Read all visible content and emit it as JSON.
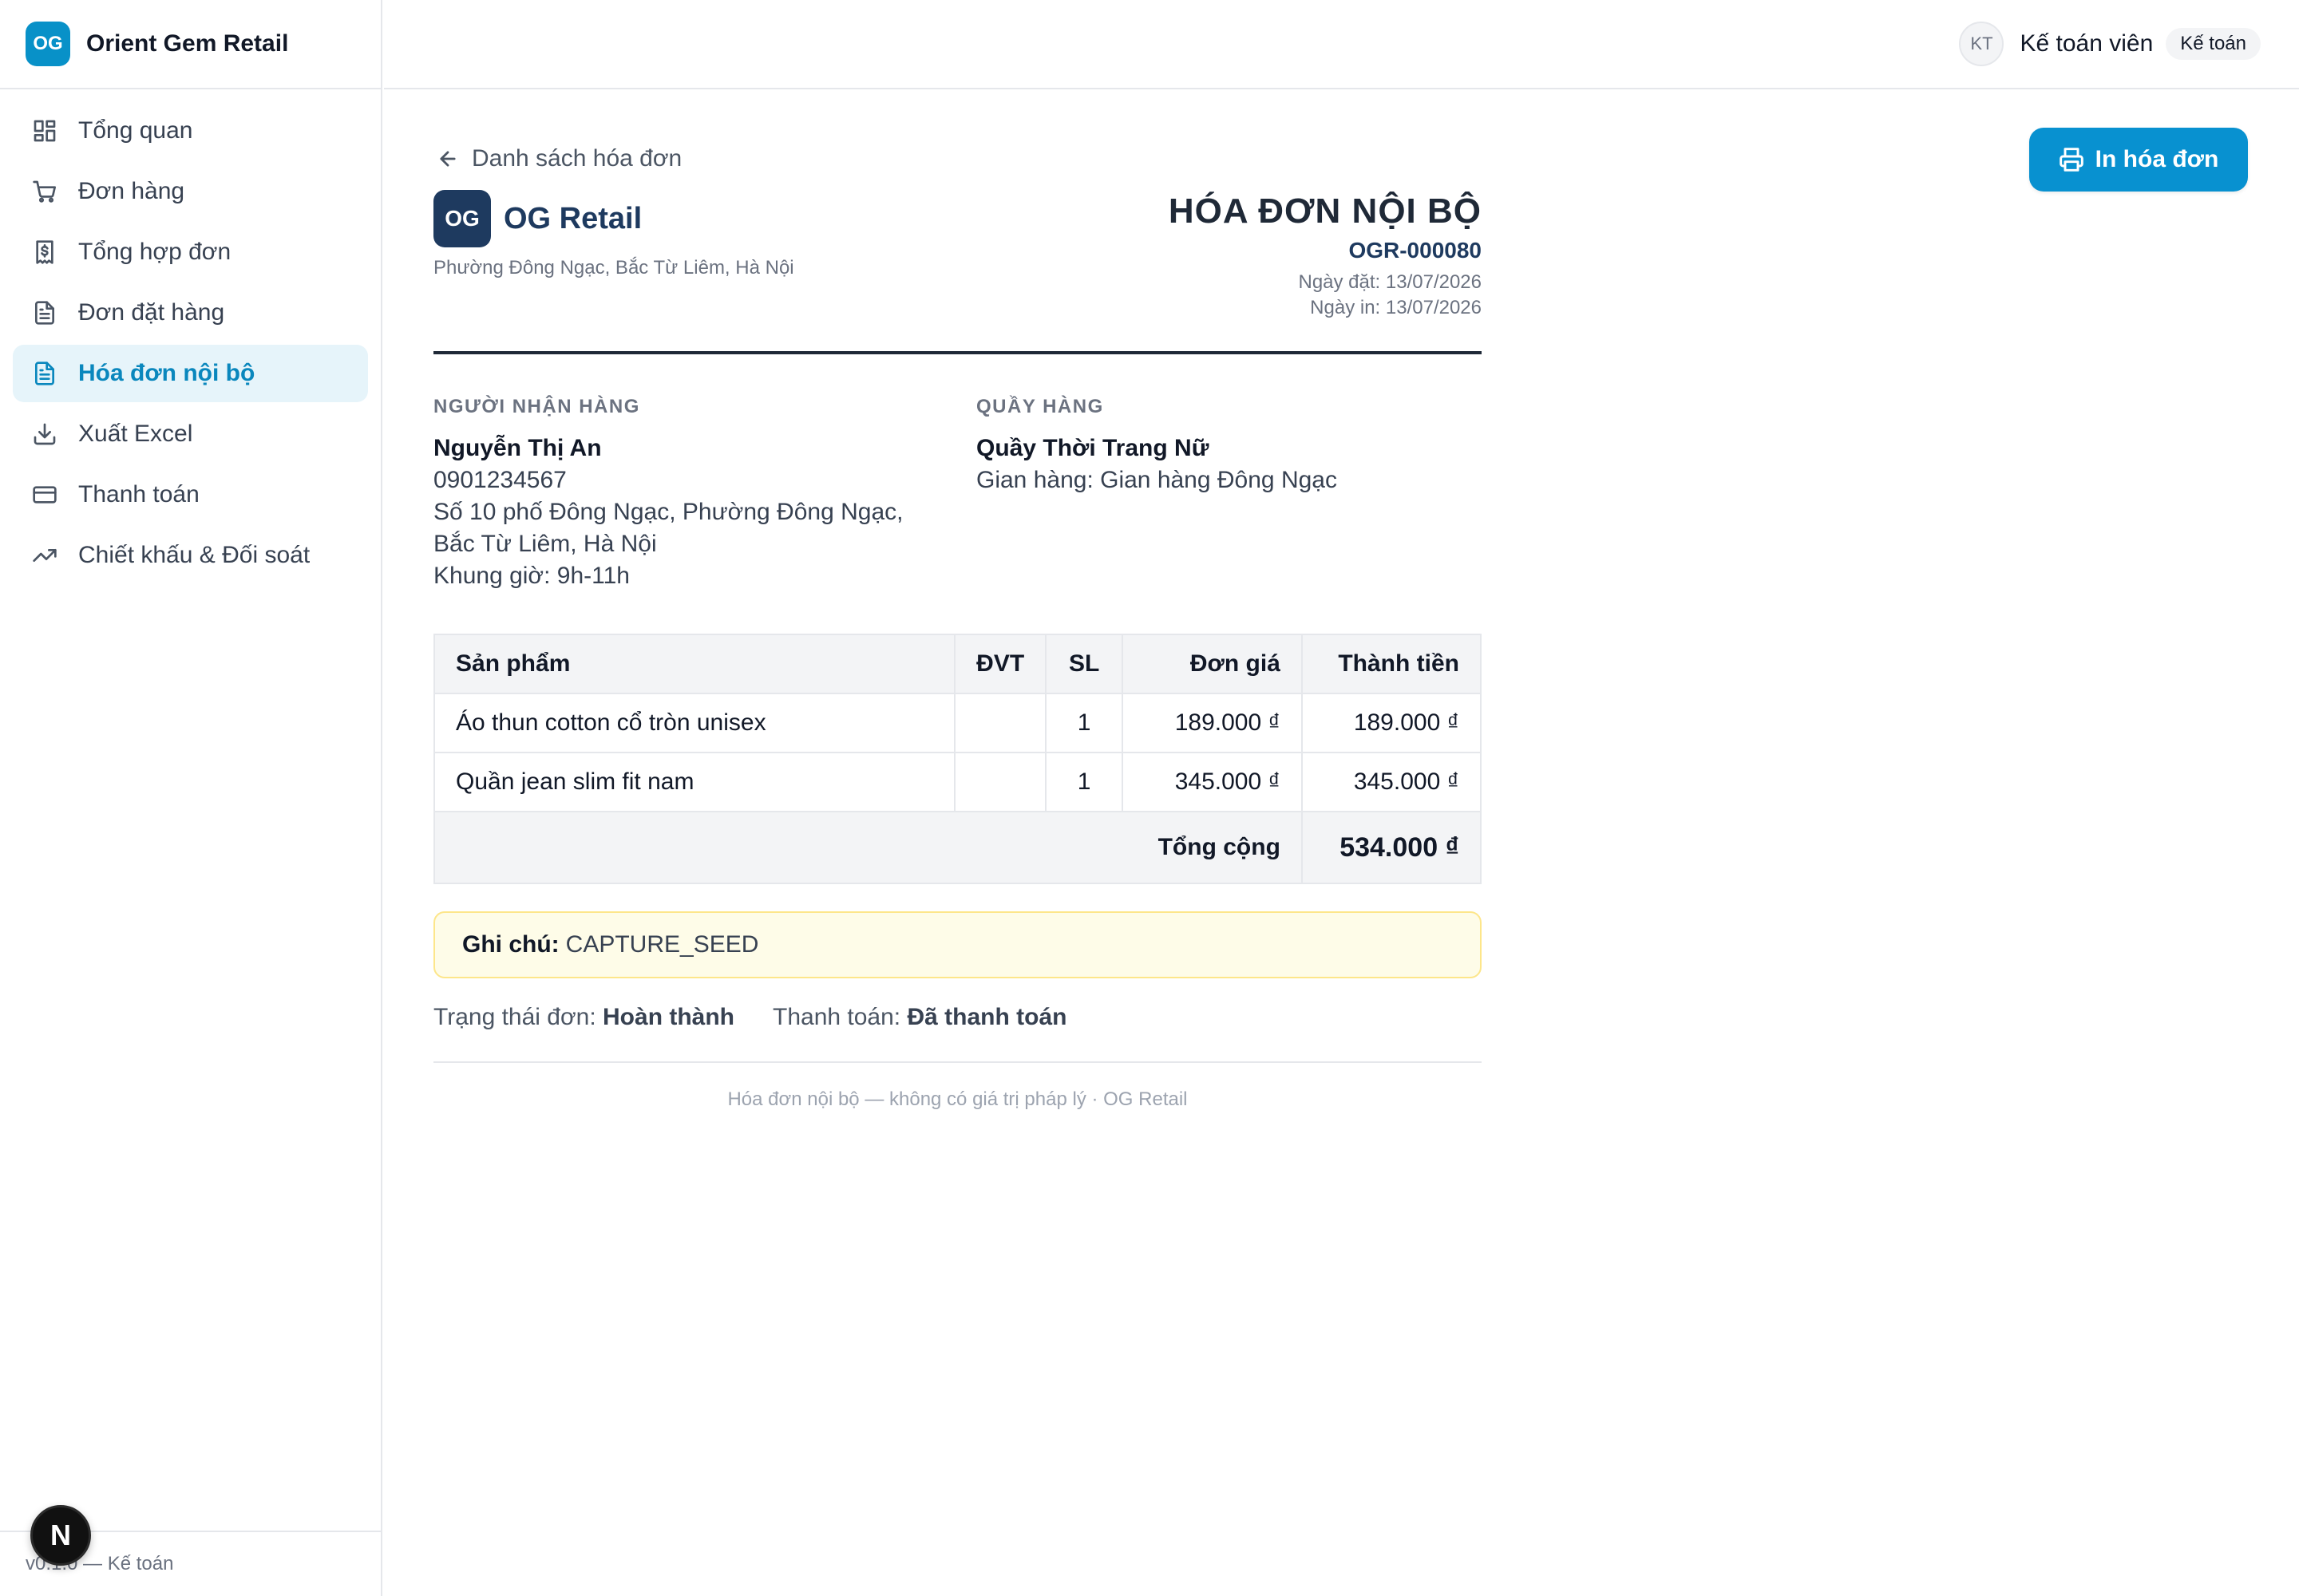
{
  "brand": {
    "logo_text": "OG",
    "name": "Orient Gem Retail"
  },
  "nav": [
    {
      "label": "Tổng quan",
      "icon": "dashboard-icon"
    },
    {
      "label": "Đơn hàng",
      "icon": "cart-icon"
    },
    {
      "label": "Tổng hợp đơn",
      "icon": "dollar-receipt-icon"
    },
    {
      "label": "Đơn đặt hàng",
      "icon": "document-icon"
    },
    {
      "label": "Hóa đơn nội bộ",
      "icon": "document-icon",
      "active": true
    },
    {
      "label": "Xuất Excel",
      "icon": "download-icon"
    },
    {
      "label": "Thanh toán",
      "icon": "credit-card-icon"
    },
    {
      "label": "Chiết khấu & Đối soát",
      "icon": "trend-up-icon"
    }
  ],
  "sidebar_footer": "v0.1.0 — Kế toán",
  "next_badge": "N",
  "user": {
    "initials": "KT",
    "name": "Kế toán viên",
    "role": "Kế toán"
  },
  "actions": {
    "back_label": "Danh sách hóa đơn",
    "print_label": "In hóa đơn"
  },
  "invoice": {
    "company_logo": "OG",
    "company_name": "OG Retail",
    "company_address": "Phường Đông Ngạc, Bắc Từ Liêm, Hà Nội",
    "title": "HÓA ĐƠN NỘI BỘ",
    "code": "OGR-000080",
    "order_date": "Ngày đặt: 13/07/2026",
    "print_date": "Ngày in: 13/07/2026",
    "recipient": {
      "label": "NGƯỜI NHẬN HÀNG",
      "name": "Nguyễn Thị An",
      "phone": "0901234567",
      "address": "Số 10 phố Đông Ngạc, Phường Đông Ngạc, Bắc Từ Liêm, Hà Nội",
      "time_slot": "Khung giờ: 9h-11h"
    },
    "counter": {
      "label": "QUẦY HÀNG",
      "name": "Quầy Thời Trang Nữ",
      "store": "Gian hàng: Gian hàng Đông Ngạc"
    },
    "table": {
      "headers": [
        "Sản phẩm",
        "ĐVT",
        "SL",
        "Đơn giá",
        "Thành tiền"
      ],
      "rows": [
        {
          "product": "Áo thun cotton cổ tròn unisex",
          "unit": "",
          "qty": "1",
          "price": "189.000 ₫",
          "total": "189.000 ₫"
        },
        {
          "product": "Quần jean slim fit nam",
          "unit": "",
          "qty": "1",
          "price": "345.000 ₫",
          "total": "345.000 ₫"
        }
      ],
      "total_label": "Tổng cộng",
      "total_value": "534.000 ₫"
    },
    "note_label": "Ghi chú:",
    "note_value": "CAPTURE_SEED",
    "order_status_label": "Trạng thái đơn:",
    "order_status_value": "Hoàn thành",
    "payment_status_label": "Thanh toán:",
    "payment_status_value": "Đã thanh toán",
    "footer": "Hóa đơn nội bộ — không có giá trị pháp lý · OG Retail"
  },
  "colors": {
    "accent": "#0891c8",
    "active_bg": "#e6f4fa",
    "navy": "#1e3a5f",
    "note_bg": "#fefce8",
    "note_border": "#fde68a"
  }
}
